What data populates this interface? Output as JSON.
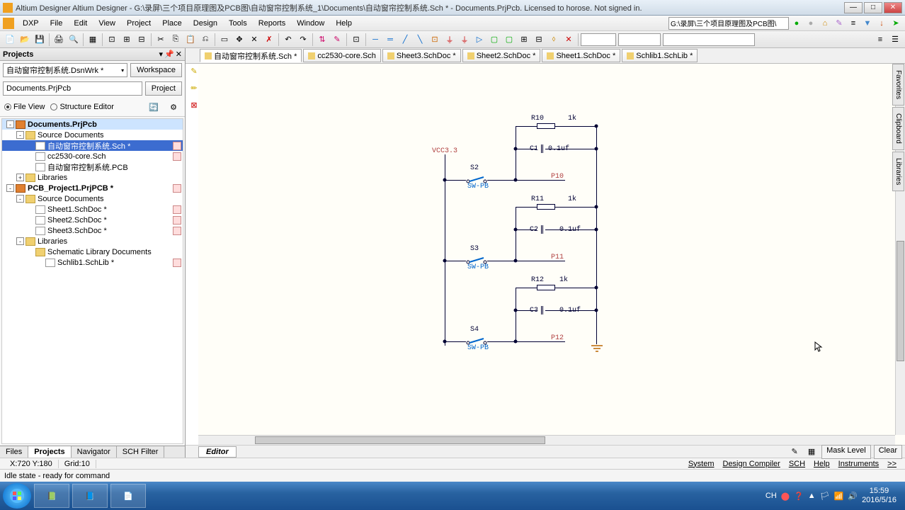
{
  "titlebar": {
    "text": "Altium Designer Altium Designer - G:\\录屏\\三个项目原理图及PCB图\\自动窗帘控制系统_1\\Documents\\自动窗帘控制系统.Sch * - Documents.PrjPcb. Licensed to horose. Not signed in."
  },
  "menu": {
    "dxp": "DXP",
    "file": "File",
    "edit": "Edit",
    "view": "View",
    "project": "Project",
    "place": "Place",
    "design": "Design",
    "tools": "Tools",
    "reports": "Reports",
    "window": "Window",
    "help": "Help",
    "path": "G:\\录屏\\三个项目原理图及PCB图\\"
  },
  "projects_panel": {
    "title": "Projects",
    "workspace_combo": "自动窗帘控制系统.DsnWrk *",
    "workspace_btn": "Workspace",
    "project_combo": "Documents.PrjPcb",
    "project_btn": "Project",
    "radio_file": "File View",
    "radio_structure": "Structure Editor",
    "tree": [
      {
        "level": 0,
        "exp": "-",
        "icon": "proj",
        "label": "Documents.PrjPcb",
        "bold": true,
        "sel": true
      },
      {
        "level": 1,
        "exp": "-",
        "icon": "folder",
        "label": "Source Documents"
      },
      {
        "level": 2,
        "exp": "",
        "icon": "doc",
        "label": "自动窗帘控制系统.Sch *",
        "hl": true,
        "mod": true
      },
      {
        "level": 2,
        "exp": "",
        "icon": "doc",
        "label": "cc2530-core.Sch",
        "mod": true
      },
      {
        "level": 2,
        "exp": "",
        "icon": "doc",
        "label": "自动窗帘控制系统.PCB"
      },
      {
        "level": 1,
        "exp": "+",
        "icon": "folder",
        "label": "Libraries"
      },
      {
        "level": 0,
        "exp": "-",
        "icon": "proj",
        "label": "PCB_Project1.PrjPCB *",
        "bold": true,
        "mod": true
      },
      {
        "level": 1,
        "exp": "-",
        "icon": "folder",
        "label": "Source Documents"
      },
      {
        "level": 2,
        "exp": "",
        "icon": "doc",
        "label": "Sheet1.SchDoc *",
        "mod": true
      },
      {
        "level": 2,
        "exp": "",
        "icon": "doc",
        "label": "Sheet2.SchDoc *",
        "mod": true
      },
      {
        "level": 2,
        "exp": "",
        "icon": "doc",
        "label": "Sheet3.SchDoc *",
        "mod": true
      },
      {
        "level": 1,
        "exp": "-",
        "icon": "folder",
        "label": "Libraries"
      },
      {
        "level": 2,
        "exp": "",
        "icon": "folder",
        "label": "Schematic Library Documents"
      },
      {
        "level": 3,
        "exp": "",
        "icon": "doc",
        "label": "Schlib1.SchLib *",
        "mod": true
      }
    ],
    "tabs": {
      "files": "Files",
      "projects": "Projects",
      "navigator": "Navigator",
      "schfilter": "SCH Filter"
    }
  },
  "doc_tabs": [
    {
      "label": "自动窗帘控制系统.Sch *",
      "active": true
    },
    {
      "label": "cc2530-core.Sch"
    },
    {
      "label": "Sheet3.SchDoc *"
    },
    {
      "label": "Sheet2.SchDoc *"
    },
    {
      "label": "Sheet1.SchDoc *"
    },
    {
      "label": "Schlib1.SchLib *"
    }
  ],
  "schematic": {
    "vcc": "VCC3.3",
    "r10": "R10",
    "r10v": "1k",
    "r11": "R11",
    "r11v": "1k",
    "r12": "R12",
    "r12v": "1k",
    "c1": "C1",
    "c1v": "0.1uf",
    "c2": "C2",
    "c2v": "0.1uf",
    "c3": "C3",
    "c3v": "0.1uf",
    "s2": "S2",
    "s2v": "SW-PB",
    "s3": "S3",
    "s3v": "SW-PB",
    "s4": "S4",
    "s4v": "SW-PB",
    "p10": "P10",
    "p11": "P11",
    "p12": "P12"
  },
  "editor_tab": "Editor",
  "editor_right": {
    "mask": "Mask Level",
    "clear": "Clear"
  },
  "side_tabs": {
    "favorites": "Favorites",
    "clipboard": "Clipboard",
    "libraries": "Libraries"
  },
  "status1": {
    "coords": "X:720 Y:180",
    "grid": "Grid:10",
    "links": {
      "system": "System",
      "design_compiler": "Design Compiler",
      "sch": "SCH",
      "help": "Help",
      "instruments": "Instruments",
      "more": ">>"
    }
  },
  "status2": {
    "idle": "Idle state - ready for command"
  },
  "taskbar": {
    "lang": "CH",
    "time": "15:59",
    "date": "2016/5/16"
  }
}
